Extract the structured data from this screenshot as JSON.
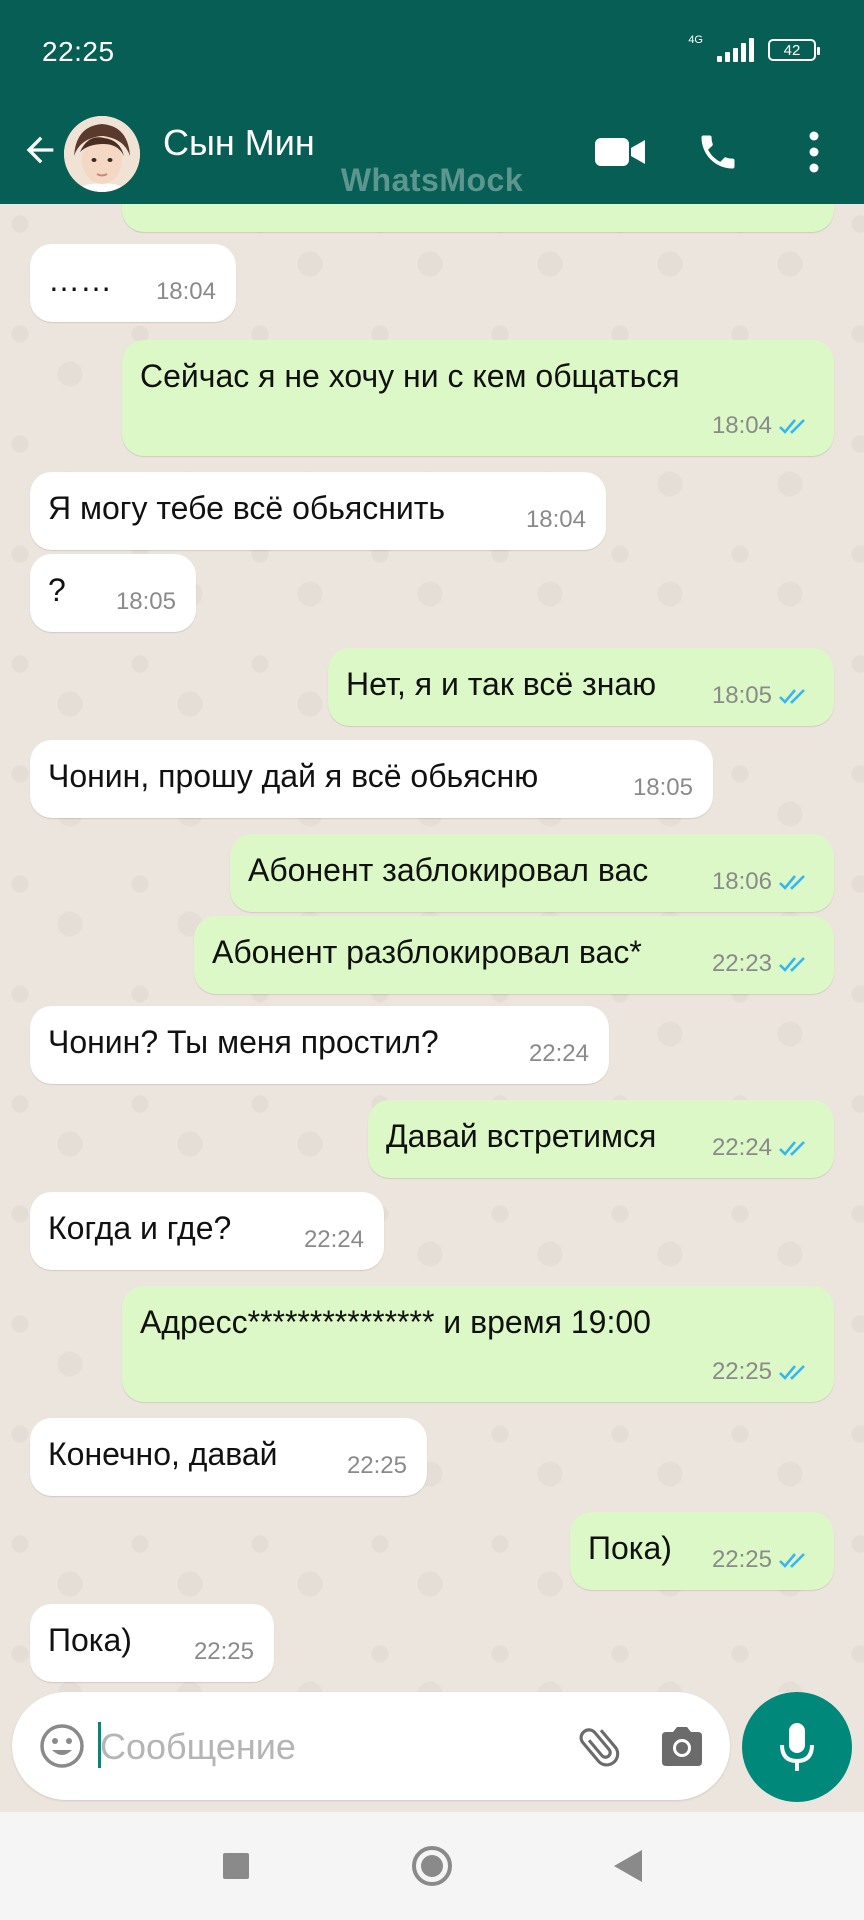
{
  "status_bar": {
    "time": "22:25",
    "network": "4G",
    "battery": "42"
  },
  "header": {
    "contact_name": "Сын Мин",
    "watermark": "WhatsMock",
    "icons": [
      "back-arrow-icon",
      "video-call-icon",
      "phone-icon",
      "more-vert-icon"
    ],
    "color": "#075e54"
  },
  "messages": [
    {
      "dir": "in",
      "text": "……",
      "time": "18:04"
    },
    {
      "dir": "out",
      "text": "Сейчас я не хочу ни с кем общаться",
      "time": "18:04"
    },
    {
      "dir": "in",
      "text": "Я могу тебе всё обьяснить",
      "time": "18:04"
    },
    {
      "dir": "in",
      "text": "?",
      "time": "18:05"
    },
    {
      "dir": "out",
      "text": "Нет, я и так всё знаю",
      "time": "18:05"
    },
    {
      "dir": "in",
      "text": "Чонин, прошу дай я всё обьясню",
      "time": "18:05"
    },
    {
      "dir": "out",
      "text": "Абонент заблокировал вас",
      "time": "18:06"
    },
    {
      "dir": "out",
      "text": "Абонент разблокировал вас*",
      "time": "22:23"
    },
    {
      "dir": "in",
      "text": "Чонин? Ты меня простил?",
      "time": "22:24"
    },
    {
      "dir": "out",
      "text": "Давай встретимся",
      "time": "22:24"
    },
    {
      "dir": "in",
      "text": "Когда и где?",
      "time": "22:24"
    },
    {
      "dir": "out",
      "text": "Адресс*************** и время 19:00",
      "time": "22:25"
    },
    {
      "dir": "in",
      "text": "Конечно, давай",
      "time": "22:25"
    },
    {
      "dir": "out",
      "text": "Пока)",
      "time": "22:25"
    },
    {
      "dir": "in",
      "text": "Пока)",
      "time": "22:25"
    }
  ],
  "input": {
    "placeholder": "Сообщение"
  },
  "colors": {
    "outgoing_bubble": "#dcf8c6",
    "incoming_bubble": "#ffffff",
    "read_ticks": "#34b7f1",
    "mic_button": "#00897b"
  }
}
